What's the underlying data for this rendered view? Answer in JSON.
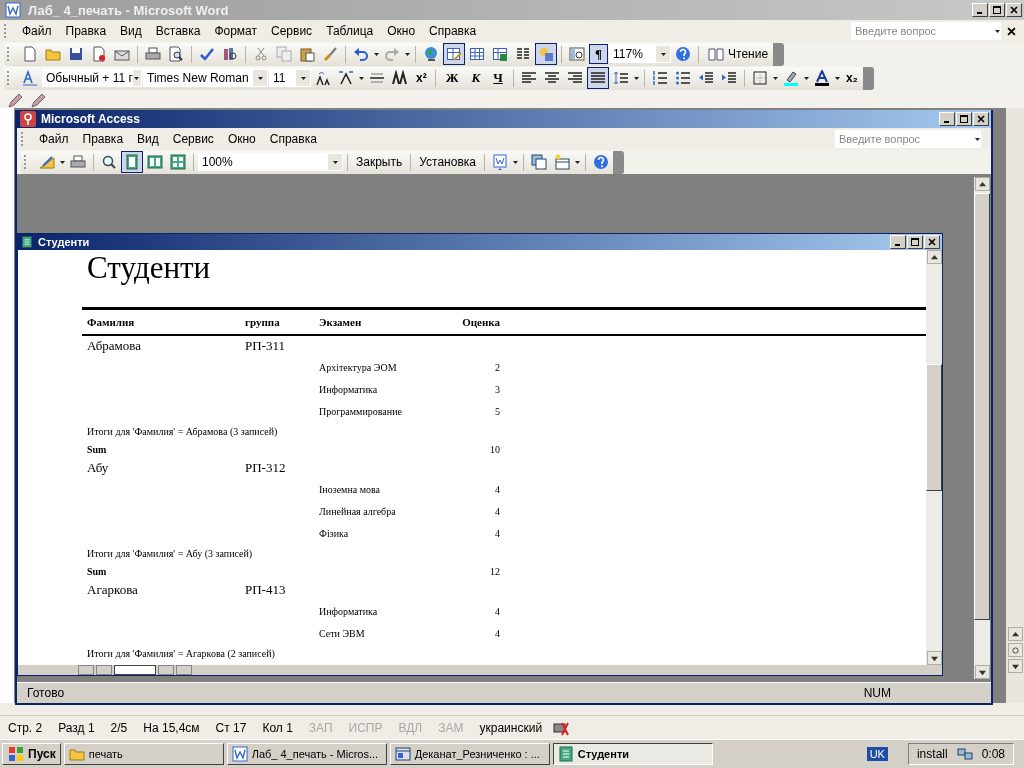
{
  "word": {
    "title": "Лаб_ 4_печать - Microsoft Word",
    "menu": [
      "Файл",
      "Правка",
      "Вид",
      "Вставка",
      "Формат",
      "Сервис",
      "Таблица",
      "Окно",
      "Справка"
    ],
    "help_search": {
      "placeholder": "Введите вопрос"
    },
    "standard_toolbar": {
      "tables_borders_selected": true,
      "drawing_selected": true,
      "pilcrow": "¶",
      "pilcrow_selected": true,
      "zoom": "117%",
      "reading_button": "Чтение"
    },
    "formatting_toolbar": {
      "style": "Обычный + 11 г",
      "font": "Times New Roman",
      "size": "11",
      "superscript": "x²",
      "bold": "Ж",
      "italic": "К",
      "underline": "Ч",
      "justify_selected": true,
      "subscript": "x₂"
    },
    "status_bar": [
      {
        "text": "Стр. 2",
        "disabled": false
      },
      {
        "text": "Разд 1",
        "disabled": false
      },
      {
        "text": "2/5",
        "disabled": false
      },
      {
        "text": "На 15,4см",
        "disabled": false
      },
      {
        "text": "Ст 17",
        "disabled": false
      },
      {
        "text": "Кол 1",
        "disabled": false
      },
      {
        "text": "ЗАП",
        "disabled": true
      },
      {
        "text": "ИСПР",
        "disabled": true
      },
      {
        "text": "ВДЛ",
        "disabled": true
      },
      {
        "text": "ЗАМ",
        "disabled": true
      },
      {
        "text": "украинский",
        "disabled": false
      }
    ]
  },
  "access": {
    "title": "Microsoft Access",
    "menu": [
      "Файл",
      "Правка",
      "Вид",
      "Сервис",
      "Окно",
      "Справка"
    ],
    "help_search": {
      "placeholder": "Введите вопрос"
    },
    "toolbar": {
      "one_page_selected": true,
      "zoom": "100%",
      "buttons": [
        "Закрыть",
        "Установка"
      ]
    },
    "status_bar": {
      "message": "Готово",
      "indicator": "NUM"
    }
  },
  "report_window": {
    "title": "Студенти",
    "report": {
      "title": "Студенти",
      "columns": [
        "Фамилия",
        "группа",
        "Экзамен",
        "Оценка"
      ],
      "groups": [
        {
          "surname": "Абрамова",
          "group": "РП-311",
          "exams": [
            {
              "exam": "Архітектура ЭОМ",
              "grade": "2"
            },
            {
              "exam": "Информатика",
              "grade": "3"
            },
            {
              "exam": "Программирование",
              "grade": "5"
            }
          ],
          "summary": "Итоги для 'Фамилия' =  Абрамова (3 записей)",
          "sum_label": "Sum",
          "sum": "10"
        },
        {
          "surname": "Абу",
          "group": "РП-312",
          "exams": [
            {
              "exam": "Іноземна мова",
              "grade": "4"
            },
            {
              "exam": "Линейная алгебра",
              "grade": "4"
            },
            {
              "exam": "Фізика",
              "grade": "4"
            }
          ],
          "summary": "Итоги для 'Фамилия' =  Абу (3 записей)",
          "sum_label": "Sum",
          "sum": "12"
        },
        {
          "surname": "Агаркова",
          "group": "РП-413",
          "exams": [
            {
              "exam": "Информатика",
              "grade": "4"
            },
            {
              "exam": "Сети ЭВМ",
              "grade": "4"
            }
          ],
          "summary": "Итоги для 'Фамилия' =  Агаркова (2 записей)"
        }
      ]
    }
  },
  "taskbar": {
    "start": "Пуск",
    "tasks": [
      {
        "label": "печать",
        "selected": false,
        "kind": "folder"
      },
      {
        "label": "Лаб_ 4_печать - Micros...",
        "selected": false,
        "kind": "word"
      },
      {
        "label": "Деканат_Резниченко : ...",
        "selected": false,
        "kind": "database"
      },
      {
        "label": "Студенти",
        "selected": true,
        "kind": "report"
      }
    ],
    "language": "UK",
    "tray_label": "install",
    "time": "0:08"
  }
}
